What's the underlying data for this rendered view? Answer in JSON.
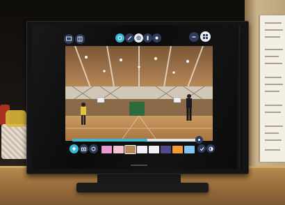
{
  "photo": {
    "subject": "tv-monitor-showing-gym-video-app",
    "colors": {
      "wall": "#18130f",
      "wood_panel": "#c9b48c",
      "notice_paper": "#f4efe4",
      "monitor_bezel": "#141414",
      "gym_floor": "#b8874e",
      "gym_ceiling": "#b07e4e",
      "accent_cyan": "#36b7d6"
    }
  },
  "screen_ui": {
    "top_toolbar": {
      "left_icons": [
        "display-icon",
        "layout-icon"
      ],
      "center_icons": [
        "color-wheel-icon",
        "pen-icon",
        "target-icon",
        "brush-icon",
        "record-icon"
      ],
      "right_icons": [
        "minus-icon",
        "grid-icon"
      ]
    },
    "playback": {
      "progress": 0.6
    },
    "bottom_bar": {
      "left_icons": [
        "marker-icon",
        "camera-icon",
        "eye-icon"
      ],
      "right_icons": [
        "check-icon",
        "contrast-icon"
      ],
      "swatch_colors": [
        "#e79ad0",
        "#f4c4d0",
        "#b8885a",
        "#f6eef6",
        "#f0f0f4",
        "#4e4a8c",
        "#f29a3a",
        "#7fc6f0"
      ]
    }
  }
}
